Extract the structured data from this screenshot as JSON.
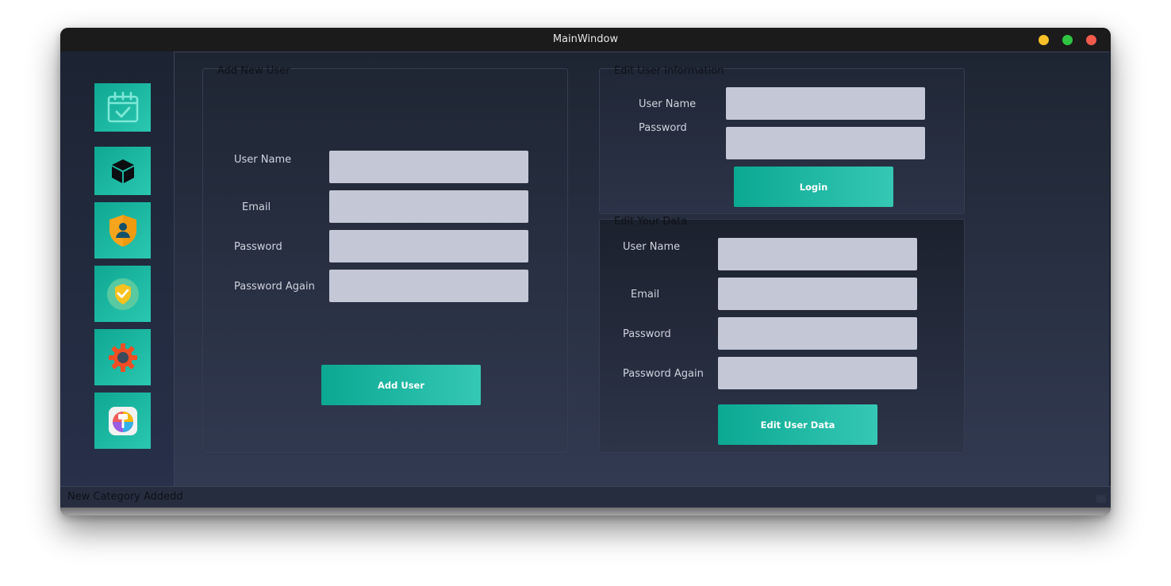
{
  "window": {
    "title": "MainWindow"
  },
  "sidebar": {
    "items": [
      {
        "icon": "calendar-check-icon"
      },
      {
        "icon": "cube-icon"
      },
      {
        "icon": "user-shield-icon"
      },
      {
        "icon": "shield-check-icon"
      },
      {
        "icon": "gear-icon"
      },
      {
        "icon": "paint-brush-icon"
      }
    ]
  },
  "add_user": {
    "title": "Add New User",
    "username_label": "User Name",
    "email_label": "Email",
    "password_label": "Password",
    "password_again_label": "Password Again",
    "username_value": "",
    "email_value": "",
    "password_value": "",
    "password_again_value": "",
    "button_label": "Add User"
  },
  "edit_user_info": {
    "title": "Edit User Information",
    "username_label": "User Name",
    "password_label": "Password",
    "username_value": "",
    "password_value": "",
    "button_label": "Login"
  },
  "edit_your_data": {
    "title": "Edit Your Data",
    "username_label": "User Name",
    "email_label": "Email",
    "password_label": "Password",
    "password_again_label": "Password Again",
    "username_value": "",
    "email_value": "",
    "password_value": "",
    "password_again_value": "",
    "button_label": "Edit User Data"
  },
  "statusbar": {
    "message": "New Category Addedd"
  },
  "colors": {
    "accent_start": "#0ba892",
    "accent_end": "#35c8b4",
    "field_bg": "#c4c8d6",
    "panel_bg": "#1e2532",
    "traffic_minimize": "#f5c028",
    "traffic_maximize": "#2fc441",
    "traffic_close": "#f25a4c"
  }
}
